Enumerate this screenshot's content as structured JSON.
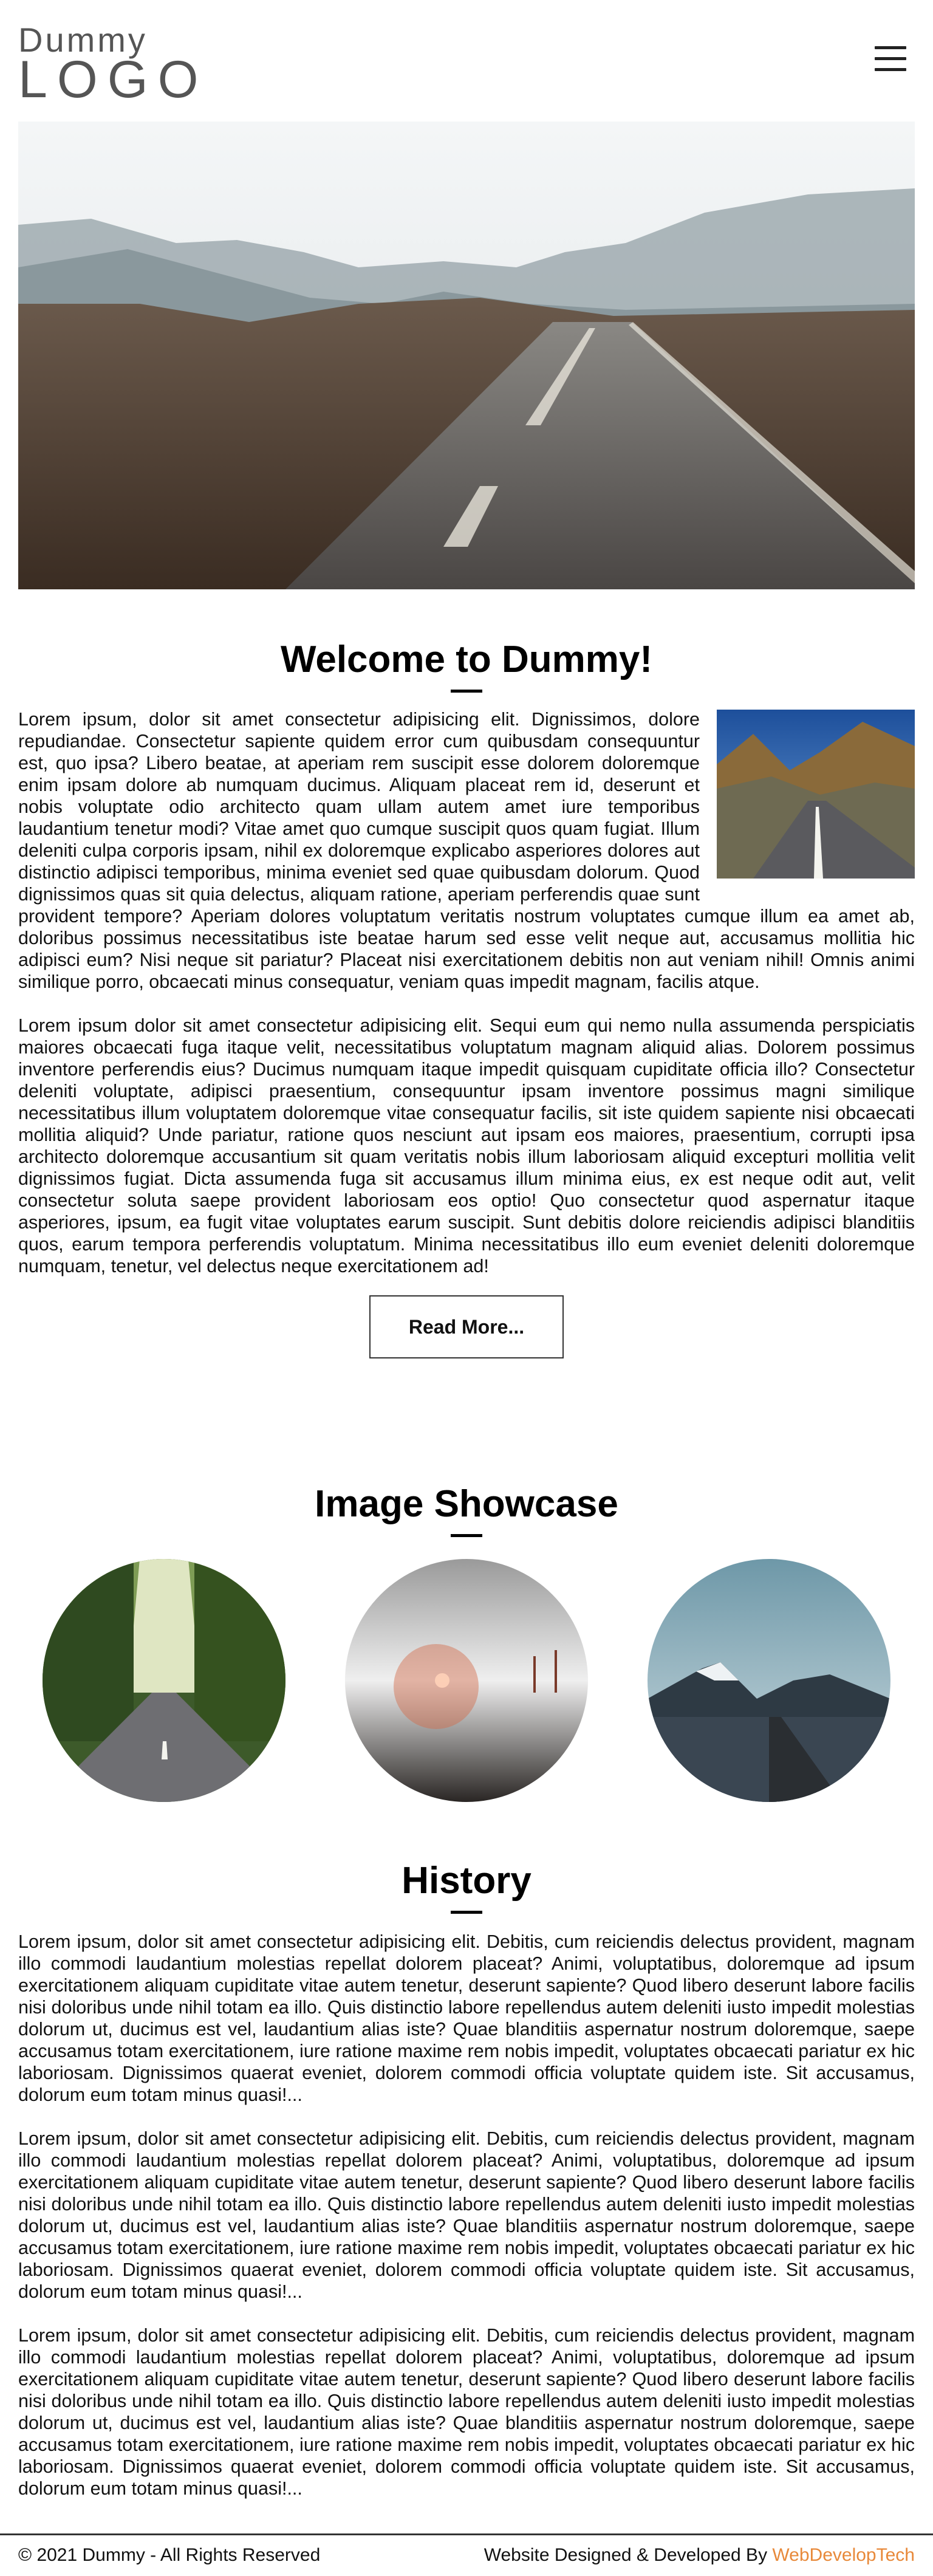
{
  "header": {
    "logo_top": "Dummy",
    "logo_bottom": "LOGO",
    "menu_icon": "hamburger-menu-icon"
  },
  "welcome": {
    "title": "Welcome to Dummy!",
    "paragraph1": "Lorem ipsum, dolor sit amet consectetur adipisicing elit. Dignissimos, dolore repudiandae. Consectetur sapiente quidem error cum quibusdam consequuntur est, quo ipsa? Libero beatae, at aperiam rem suscipit esse dolorem doloremque enim ipsam dolore ab numquam ducimus. Aliquam placeat rem id, deserunt et nobis voluptate odio architecto quam ullam autem amet iure temporibus laudantium tenetur modi? Vitae amet quo cumque suscipit quos quam fugiat. Illum deleniti culpa corporis ipsam, nihil ex doloremque explicabo asperiores dolores aut distinctio adipisci temporibus, minima eveniet sed quae quibusdam dolorum. Quod dignissimos quas sit quia delectus, aliquam ratione, aperiam perferendis quae sunt provident tempore? Aperiam dolores voluptatum veritatis nostrum voluptates cumque illum ea amet ab, doloribus possimus necessitatibus iste beatae harum sed esse velit neque aut, accusamus mollitia hic adipisci eum? Nisi neque sit pariatur? Placeat nisi exercitationem debitis non aut veniam nihil! Omnis animi similique porro, obcaecati minus consequatur, veniam quas impedit magnam, facilis atque.",
    "paragraph2": "Lorem ipsum dolor sit amet consectetur adipisicing elit. Sequi eum qui nemo nulla assumenda perspiciatis maiores obcaecati fuga itaque velit, necessitatibus voluptatum magnam aliquid alias. Dolorem possimus inventore perferendis eius? Ducimus numquam itaque impedit quisquam cupiditate officia illo? Consectetur deleniti voluptate, adipisci praesentium, consequuntur ipsam inventore possimus magni similique necessitatibus illum voluptatem doloremque vitae consequatur facilis, sit iste quidem sapiente nisi obcaecati mollitia aliquid? Unde pariatur, ratione quos nesciunt aut ipsam eos maiores, praesentium, corrupti ipsa architecto doloremque accusantium sit quam veritatis nobis illum laboriosam aliquid excepturi mollitia velit dignissimos fugiat. Dicta assumenda fuga sit accusamus illum minima eius, ex est neque odit aut, velit consectetur soluta saepe provident laboriosam eos optio! Quo consectetur quod aspernatur itaque asperiores, ipsum, ea fugit vitae voluptates earum suscipit. Sunt debitis dolore reiciendis adipisci blanditiis quos, earum tempora perferendis voluptatum. Minima necessitatibus illo eum eveniet deleniti doloremque numquam, tenetur, vel delectus neque exercitationem ad!",
    "read_more_label": "Read More..."
  },
  "showcase": {
    "title": "Image Showcase"
  },
  "history": {
    "title": "History",
    "paragraphs": [
      "Lorem ipsum, dolor sit amet consectetur adipisicing elit. Debitis, cum reiciendis delectus provident, magnam illo commodi laudantium molestias repellat dolorem placeat? Animi, voluptatibus, doloremque ad ipsum exercitationem aliquam cupiditate vitae autem tenetur, deserunt sapiente? Quod libero deserunt labore facilis nisi doloribus unde nihil totam ea illo. Quis distinctio labore repellendus autem deleniti iusto impedit molestias dolorum ut, ducimus est vel, laudantium alias iste? Quae blanditiis aspernatur nostrum doloremque, saepe accusamus totam exercitationem, iure ratione maxime rem nobis impedit, voluptates obcaecati pariatur ex hic laboriosam. Dignissimos quaerat eveniet, dolorem commodi officia voluptate quidem iste. Sit accusamus, dolorum eum totam minus quasi!...",
      "Lorem ipsum, dolor sit amet consectetur adipisicing elit. Debitis, cum reiciendis delectus provident, magnam illo commodi laudantium molestias repellat dolorem placeat? Animi, voluptatibus, doloremque ad ipsum exercitationem aliquam cupiditate vitae autem tenetur, deserunt sapiente? Quod libero deserunt labore facilis nisi doloribus unde nihil totam ea illo. Quis distinctio labore repellendus autem deleniti iusto impedit molestias dolorum ut, ducimus est vel, laudantium alias iste? Quae blanditiis aspernatur nostrum doloremque, saepe accusamus totam exercitationem, iure ratione maxime rem nobis impedit, voluptates obcaecati pariatur ex hic laboriosam. Dignissimos quaerat eveniet, dolorem commodi officia voluptate quidem iste. Sit accusamus, dolorum eum totam minus quasi!...",
      "Lorem ipsum, dolor sit amet consectetur adipisicing elit. Debitis, cum reiciendis delectus provident, magnam illo commodi laudantium molestias repellat dolorem placeat? Animi, voluptatibus, doloremque ad ipsum exercitationem aliquam cupiditate vitae autem tenetur, deserunt sapiente? Quod libero deserunt labore facilis nisi doloribus unde nihil totam ea illo. Quis distinctio labore repellendus autem deleniti iusto impedit molestias dolorum ut, ducimus est vel, laudantium alias iste? Quae blanditiis aspernatur nostrum doloremque, saepe accusamus totam exercitationem, iure ratione maxime rem nobis impedit, voluptates obcaecati pariatur ex hic laboriosam. Dignissimos quaerat eveniet, dolorem commodi officia voluptate quidem iste. Sit accusamus, dolorum eum totam minus quasi!..."
    ]
  },
  "footer": {
    "copyright": "© 2021 Dummy - All Rights Reserved",
    "credit_prefix": "Website Designed & Developed By ",
    "credit_link": "WebDevelopTech",
    "accent_color": "#e8893a"
  }
}
